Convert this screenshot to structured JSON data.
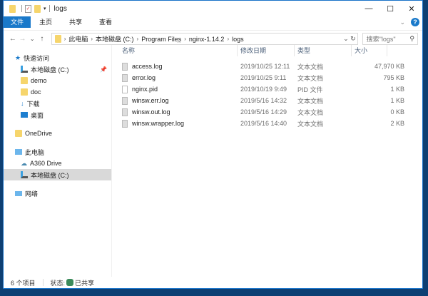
{
  "window": {
    "title": "logs",
    "minimize": "—",
    "maximize": "☐",
    "close": "✕"
  },
  "ribbon": {
    "tabs": [
      "文件",
      "主页",
      "共享",
      "查看"
    ],
    "expand": "⌄",
    "help": "?"
  },
  "nav": {
    "back": "←",
    "forward": "→",
    "recent": "⌄",
    "up": "↑"
  },
  "address": {
    "crumbs": [
      "此电脑",
      "本地磁盘 (C:)",
      "Program Files",
      "nginx-1.14.2",
      "logs"
    ],
    "dropdown": "⌄",
    "refresh": "↻"
  },
  "search": {
    "placeholder": "搜索\"logs\"",
    "icon": "search-icon"
  },
  "sidebar": {
    "quick_access": "快速访问",
    "items": [
      {
        "label": "本地磁盘 (C:)",
        "icon": "drive-icon",
        "pinned": true
      },
      {
        "label": "demo",
        "icon": "folder-icon"
      },
      {
        "label": "doc",
        "icon": "folder-icon"
      },
      {
        "label": "下载",
        "icon": "download-icon"
      },
      {
        "label": "桌面",
        "icon": "desktop-icon"
      }
    ],
    "onedrive": "OneDrive",
    "this_pc": "此电脑",
    "pc_items": [
      {
        "label": "A360 Drive",
        "icon": "cloud-drive-icon"
      },
      {
        "label": "本地磁盘 (C:)",
        "icon": "drive-icon",
        "selected": true
      }
    ],
    "network": "网络"
  },
  "columns": [
    "名称",
    "修改日期",
    "类型",
    "大小"
  ],
  "files": [
    {
      "name": "access.log",
      "date": "2019/10/25 12:11",
      "type": "文本文档",
      "size": "47,970 KB"
    },
    {
      "name": "error.log",
      "date": "2019/10/25 9:11",
      "type": "文本文档",
      "size": "795 KB"
    },
    {
      "name": "nginx.pid",
      "date": "2019/10/19 9:49",
      "type": "PID 文件",
      "size": "1 KB"
    },
    {
      "name": "winsw.err.log",
      "date": "2019/5/16 14:32",
      "type": "文本文档",
      "size": "1 KB"
    },
    {
      "name": "winsw.out.log",
      "date": "2019/5/16 14:29",
      "type": "文本文档",
      "size": "0 KB"
    },
    {
      "name": "winsw.wrapper.log",
      "date": "2019/5/16 14:40",
      "type": "文本文档",
      "size": "2 KB"
    }
  ],
  "status": {
    "count": "6 个项目",
    "state_label": "状态:",
    "state": "已共享"
  },
  "colors": {
    "accent": "#1979ca",
    "folder": "#f6d56c",
    "desktop": "#0d3f73"
  }
}
